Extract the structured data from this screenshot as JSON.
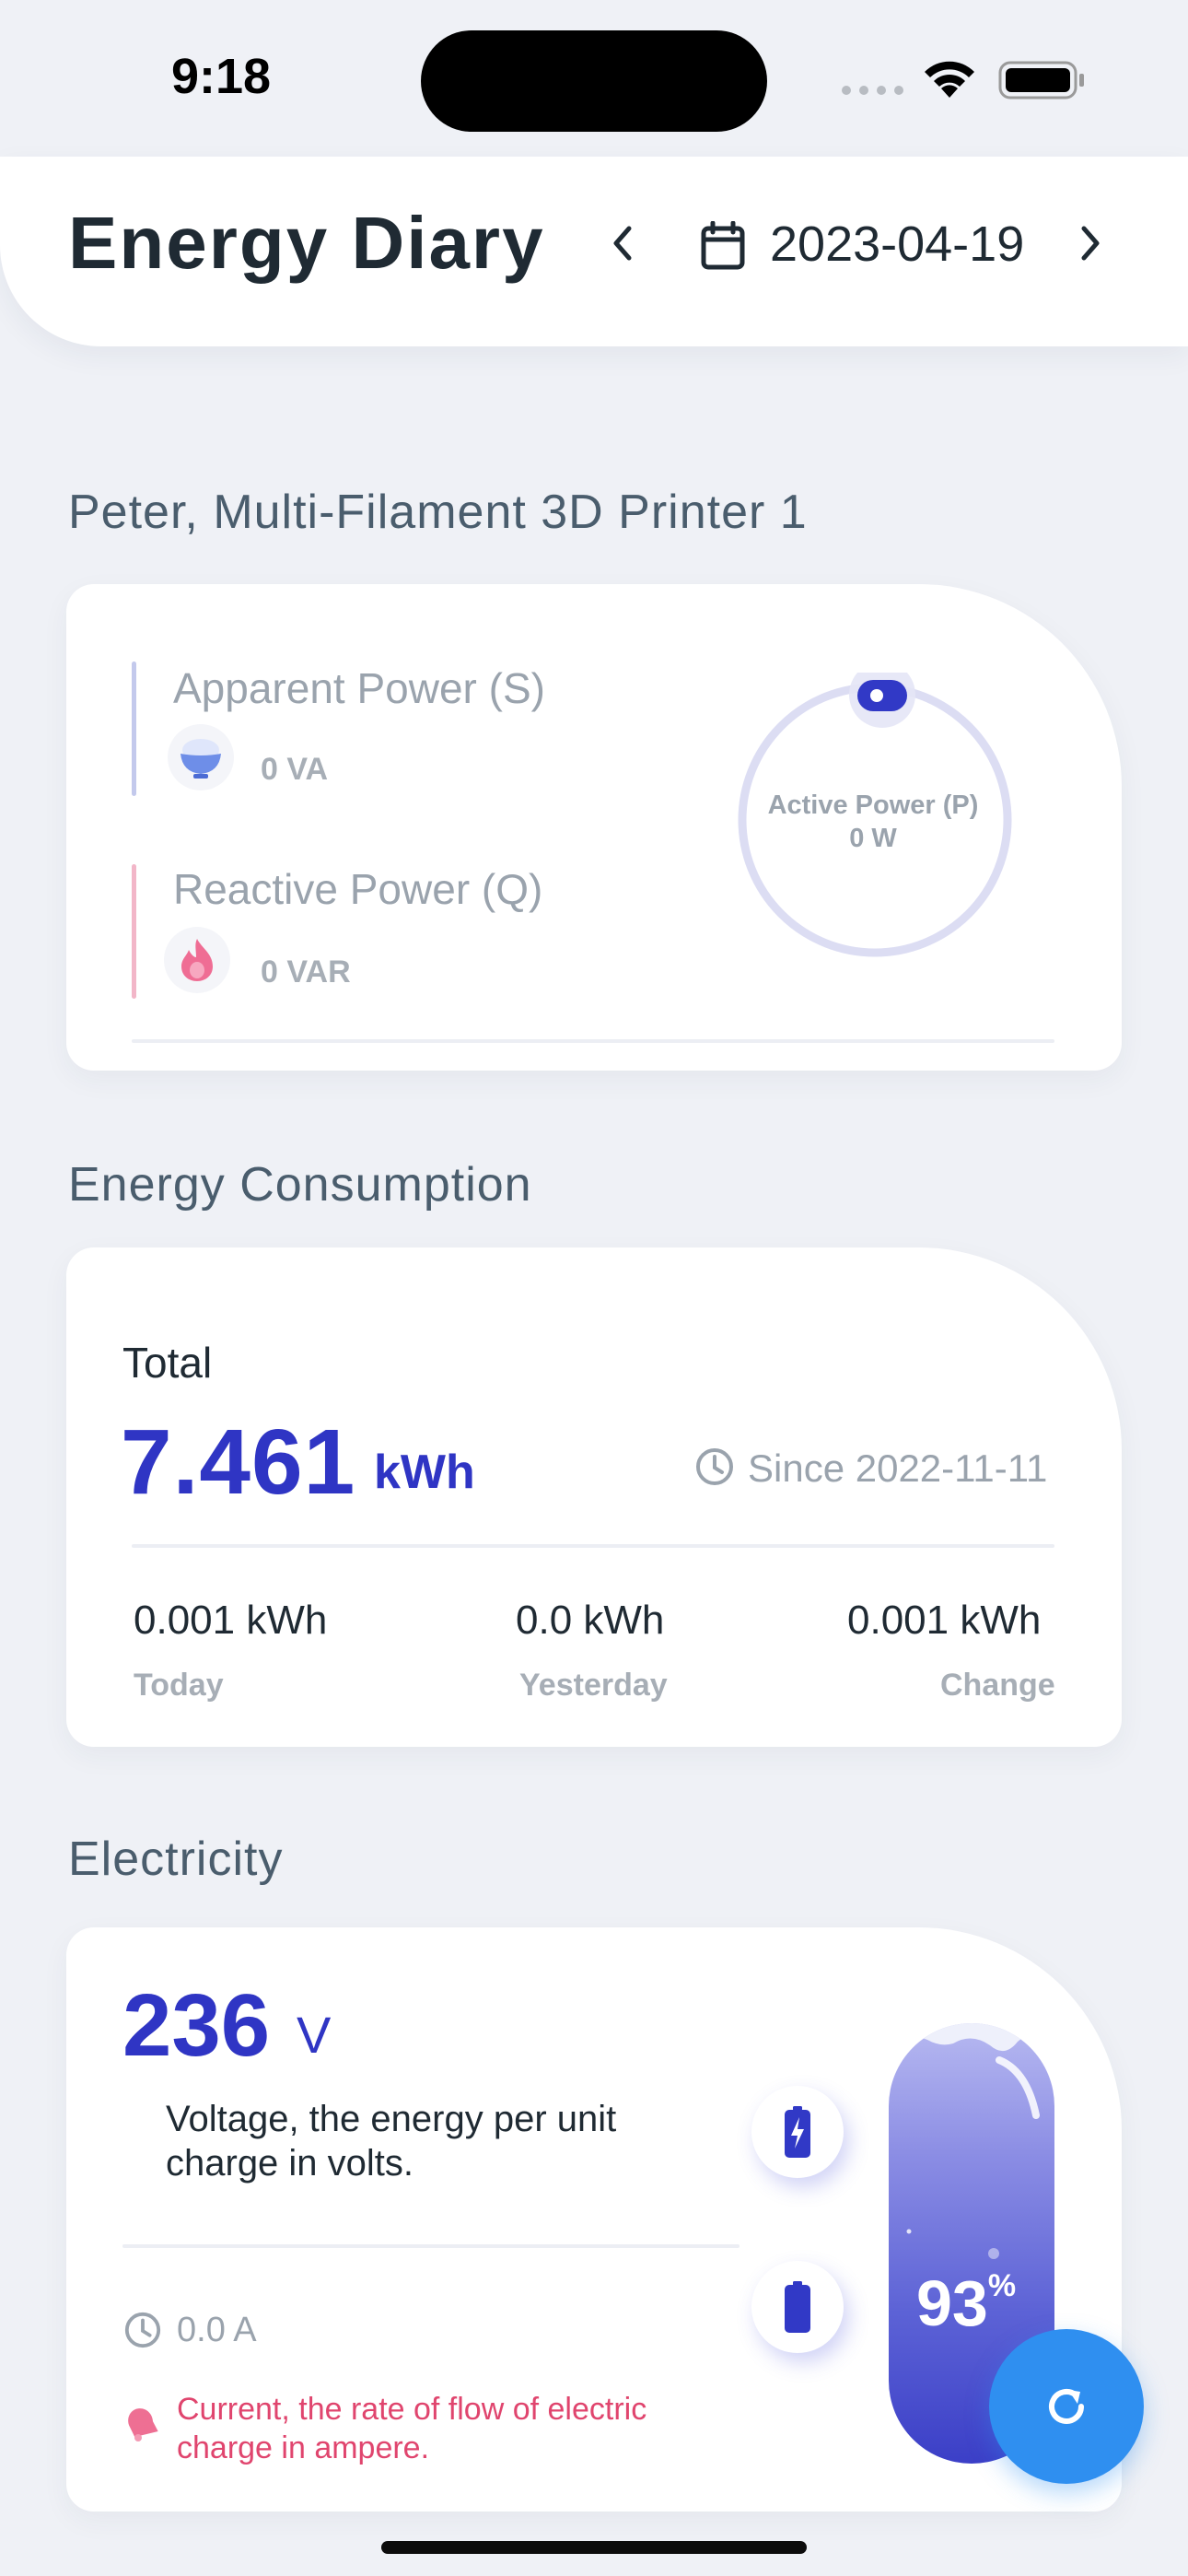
{
  "status_bar": {
    "time": "9:18"
  },
  "header": {
    "title": "Energy Diary",
    "date": "2023-04-19"
  },
  "device_section": {
    "title": "Peter, Multi-Filament 3D Printer 1",
    "apparent_power": {
      "label": "Apparent Power (S)",
      "value": "0 VA"
    },
    "reactive_power": {
      "label": "Reactive Power (Q)",
      "value": "0 VAR"
    },
    "active_power": {
      "label": "Active Power (P)",
      "value": "0 W"
    }
  },
  "consumption_section": {
    "title": "Energy Consumption",
    "total_label": "Total",
    "total_value": "7.461",
    "total_unit": "kWh",
    "since": "Since 2022-11-11",
    "stats": [
      {
        "value": "0.001 kWh",
        "label": "Today"
      },
      {
        "value": "0.0 kWh",
        "label": "Yesterday"
      },
      {
        "value": "0.001 kWh",
        "label": "Change"
      }
    ]
  },
  "electricity_section": {
    "title": "Electricity",
    "voltage_value": "236",
    "voltage_unit": "V",
    "voltage_desc": "Voltage, the energy per unit charge in volts.",
    "current_value": "0.0 A",
    "current_desc": "Current, the rate of flow of electric charge in ampere.",
    "battery_percent": "93",
    "battery_percent_sign": "%"
  },
  "colors": {
    "accent": "#2f35c4",
    "fab": "#2f8ff0",
    "current_text": "#e0456e",
    "background": "#eff1f6"
  },
  "icons": [
    "wifi-icon",
    "battery-status-icon",
    "chevron-left-icon",
    "calendar-icon",
    "chevron-right-icon",
    "rice-bowl-icon",
    "flame-icon",
    "clock-icon",
    "bell-icon",
    "battery-charging-icon",
    "battery-icon",
    "refresh-icon"
  ]
}
